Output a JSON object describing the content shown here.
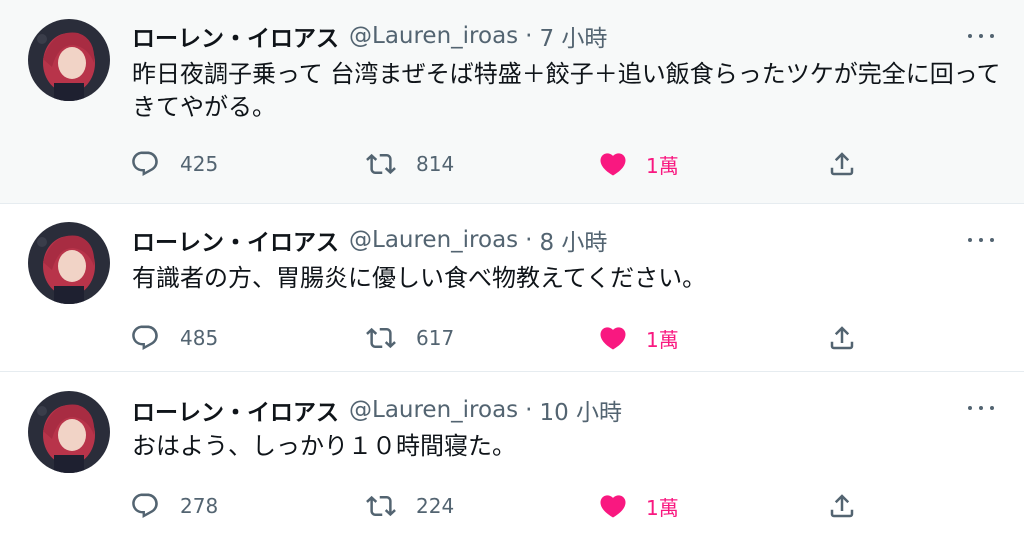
{
  "tweets": [
    {
      "display_name": "ローレン・イロアス",
      "handle": "@Lauren_iroas",
      "separator": "·",
      "time": "7 小時",
      "text": "昨日夜調子乗って 台湾まぜそば特盛＋餃子＋追い飯食らったツケが完全に回ってきてやがる。",
      "replies": "425",
      "retweets": "814",
      "likes": "1萬"
    },
    {
      "display_name": "ローレン・イロアス",
      "handle": "@Lauren_iroas",
      "separator": "·",
      "time": "8 小時",
      "text": "有識者の方、胃腸炎に優しい食べ物教えてください。",
      "replies": "485",
      "retweets": "617",
      "likes": "1萬"
    },
    {
      "display_name": "ローレン・イロアス",
      "handle": "@Lauren_iroas",
      "separator": "·",
      "time": "10 小時",
      "text": "おはよう、しっかり１０時間寝た。",
      "replies": "278",
      "retweets": "224",
      "likes": "1萬"
    }
  ],
  "icons": {
    "reply": "reply-icon",
    "retweet": "retweet-icon",
    "like": "heart-icon",
    "share": "share-icon",
    "more": "more-icon"
  },
  "colors": {
    "like_active": "#f91880",
    "muted": "#536471",
    "text": "#0f1419",
    "hover_bg": "#f7f9f9"
  }
}
